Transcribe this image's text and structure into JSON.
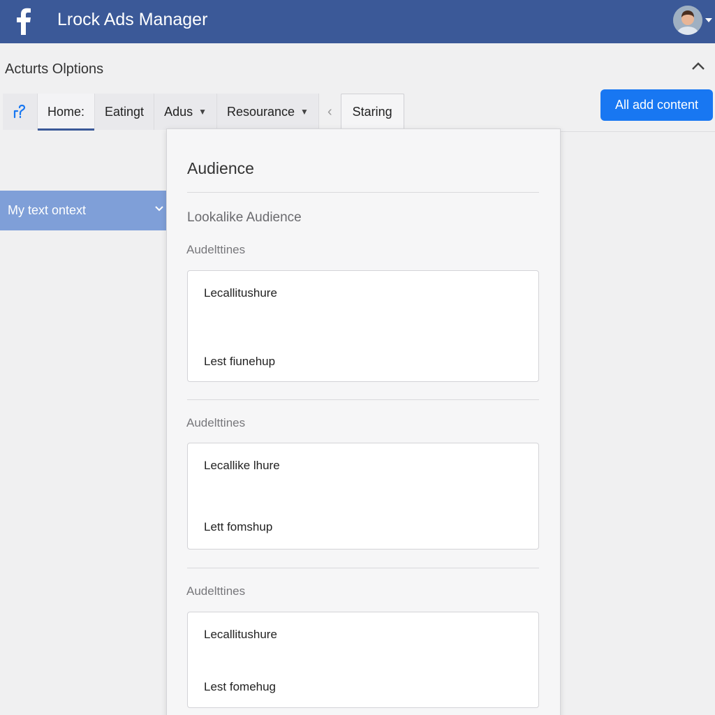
{
  "header": {
    "app_title": "Lrock Ads Manager",
    "brand_color": "#3b5998"
  },
  "options": {
    "title": "Acturts Olptions"
  },
  "tabs": [
    {
      "label": "Home:",
      "active": true
    },
    {
      "label": "Eatingt"
    },
    {
      "label": "Adus",
      "has_dropdown": true
    },
    {
      "label": "Resourance",
      "has_dropdown": true
    },
    {
      "label": "Staring"
    }
  ],
  "primary_button": {
    "label": "All add content",
    "color": "#1877f2"
  },
  "sidebar": {
    "selected_item": "My text ontext"
  },
  "panel": {
    "title": "Audience",
    "subtitle": "Lookalike Audience",
    "sections": [
      {
        "label": "Audelttines",
        "lines": [
          "Lecallitushure",
          "Lest fiunehup"
        ]
      },
      {
        "label": "Audelttines",
        "lines": [
          "Lecallike lhure",
          "Lett fomshup"
        ]
      },
      {
        "label": "Audelttines",
        "lines": [
          "Lecallitushure",
          "Lest fomehug"
        ]
      }
    ]
  }
}
